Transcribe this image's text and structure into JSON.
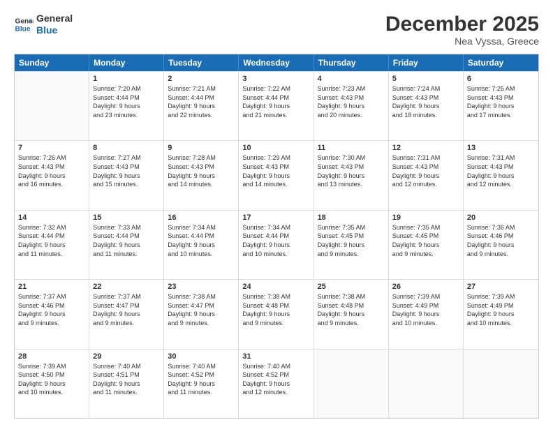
{
  "logo": {
    "line1": "General",
    "line2": "Blue"
  },
  "title": "December 2025",
  "subtitle": "Nea Vyssa, Greece",
  "days": [
    "Sunday",
    "Monday",
    "Tuesday",
    "Wednesday",
    "Thursday",
    "Friday",
    "Saturday"
  ],
  "rows": [
    [
      {
        "day": "",
        "info": ""
      },
      {
        "day": "1",
        "info": "Sunrise: 7:20 AM\nSunset: 4:44 PM\nDaylight: 9 hours\nand 23 minutes."
      },
      {
        "day": "2",
        "info": "Sunrise: 7:21 AM\nSunset: 4:44 PM\nDaylight: 9 hours\nand 22 minutes."
      },
      {
        "day": "3",
        "info": "Sunrise: 7:22 AM\nSunset: 4:44 PM\nDaylight: 9 hours\nand 21 minutes."
      },
      {
        "day": "4",
        "info": "Sunrise: 7:23 AM\nSunset: 4:43 PM\nDaylight: 9 hours\nand 20 minutes."
      },
      {
        "day": "5",
        "info": "Sunrise: 7:24 AM\nSunset: 4:43 PM\nDaylight: 9 hours\nand 18 minutes."
      },
      {
        "day": "6",
        "info": "Sunrise: 7:25 AM\nSunset: 4:43 PM\nDaylight: 9 hours\nand 17 minutes."
      }
    ],
    [
      {
        "day": "7",
        "info": "Sunrise: 7:26 AM\nSunset: 4:43 PM\nDaylight: 9 hours\nand 16 minutes."
      },
      {
        "day": "8",
        "info": "Sunrise: 7:27 AM\nSunset: 4:43 PM\nDaylight: 9 hours\nand 15 minutes."
      },
      {
        "day": "9",
        "info": "Sunrise: 7:28 AM\nSunset: 4:43 PM\nDaylight: 9 hours\nand 14 minutes."
      },
      {
        "day": "10",
        "info": "Sunrise: 7:29 AM\nSunset: 4:43 PM\nDaylight: 9 hours\nand 14 minutes."
      },
      {
        "day": "11",
        "info": "Sunrise: 7:30 AM\nSunset: 4:43 PM\nDaylight: 9 hours\nand 13 minutes."
      },
      {
        "day": "12",
        "info": "Sunrise: 7:31 AM\nSunset: 4:43 PM\nDaylight: 9 hours\nand 12 minutes."
      },
      {
        "day": "13",
        "info": "Sunrise: 7:31 AM\nSunset: 4:43 PM\nDaylight: 9 hours\nand 12 minutes."
      }
    ],
    [
      {
        "day": "14",
        "info": "Sunrise: 7:32 AM\nSunset: 4:44 PM\nDaylight: 9 hours\nand 11 minutes."
      },
      {
        "day": "15",
        "info": "Sunrise: 7:33 AM\nSunset: 4:44 PM\nDaylight: 9 hours\nand 11 minutes."
      },
      {
        "day": "16",
        "info": "Sunrise: 7:34 AM\nSunset: 4:44 PM\nDaylight: 9 hours\nand 10 minutes."
      },
      {
        "day": "17",
        "info": "Sunrise: 7:34 AM\nSunset: 4:44 PM\nDaylight: 9 hours\nand 10 minutes."
      },
      {
        "day": "18",
        "info": "Sunrise: 7:35 AM\nSunset: 4:45 PM\nDaylight: 9 hours\nand 9 minutes."
      },
      {
        "day": "19",
        "info": "Sunrise: 7:35 AM\nSunset: 4:45 PM\nDaylight: 9 hours\nand 9 minutes."
      },
      {
        "day": "20",
        "info": "Sunrise: 7:36 AM\nSunset: 4:46 PM\nDaylight: 9 hours\nand 9 minutes."
      }
    ],
    [
      {
        "day": "21",
        "info": "Sunrise: 7:37 AM\nSunset: 4:46 PM\nDaylight: 9 hours\nand 9 minutes."
      },
      {
        "day": "22",
        "info": "Sunrise: 7:37 AM\nSunset: 4:47 PM\nDaylight: 9 hours\nand 9 minutes."
      },
      {
        "day": "23",
        "info": "Sunrise: 7:38 AM\nSunset: 4:47 PM\nDaylight: 9 hours\nand 9 minutes."
      },
      {
        "day": "24",
        "info": "Sunrise: 7:38 AM\nSunset: 4:48 PM\nDaylight: 9 hours\nand 9 minutes."
      },
      {
        "day": "25",
        "info": "Sunrise: 7:38 AM\nSunset: 4:48 PM\nDaylight: 9 hours\nand 9 minutes."
      },
      {
        "day": "26",
        "info": "Sunrise: 7:39 AM\nSunset: 4:49 PM\nDaylight: 9 hours\nand 10 minutes."
      },
      {
        "day": "27",
        "info": "Sunrise: 7:39 AM\nSunset: 4:49 PM\nDaylight: 9 hours\nand 10 minutes."
      }
    ],
    [
      {
        "day": "28",
        "info": "Sunrise: 7:39 AM\nSunset: 4:50 PM\nDaylight: 9 hours\nand 10 minutes."
      },
      {
        "day": "29",
        "info": "Sunrise: 7:40 AM\nSunset: 4:51 PM\nDaylight: 9 hours\nand 11 minutes."
      },
      {
        "day": "30",
        "info": "Sunrise: 7:40 AM\nSunset: 4:52 PM\nDaylight: 9 hours\nand 11 minutes."
      },
      {
        "day": "31",
        "info": "Sunrise: 7:40 AM\nSunset: 4:52 PM\nDaylight: 9 hours\nand 12 minutes."
      },
      {
        "day": "",
        "info": ""
      },
      {
        "day": "",
        "info": ""
      },
      {
        "day": "",
        "info": ""
      }
    ]
  ]
}
